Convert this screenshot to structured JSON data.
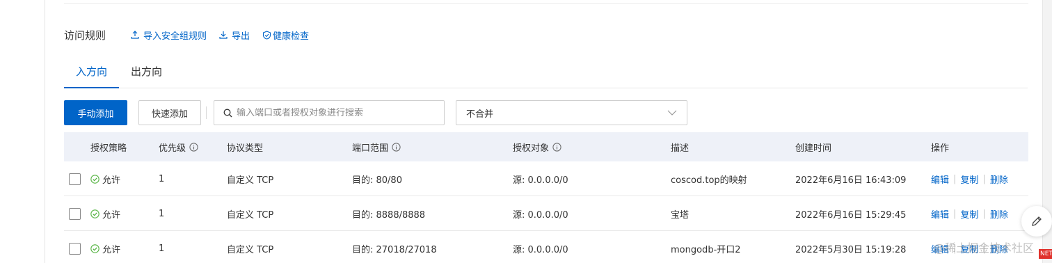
{
  "section": {
    "title": "访问规则",
    "links": {
      "import": "导入安全组规则",
      "export": "导出",
      "health": "健康检查"
    }
  },
  "tabs": {
    "inbound": "入方向",
    "outbound": "出方向"
  },
  "toolbar": {
    "manual_add": "手动添加",
    "quick_add": "快速添加",
    "search_placeholder": "输入端口或者授权对象进行搜索",
    "merge_select": "不合并"
  },
  "table": {
    "headers": {
      "policy": "授权策略",
      "priority": "优先级",
      "protocol": "协议类型",
      "port": "端口范围",
      "target": "授权对象",
      "desc": "描述",
      "created": "创建时间",
      "ops": "操作"
    },
    "rows": [
      {
        "policy": "允许",
        "priority": "1",
        "protocol": "自定义 TCP",
        "port": "目的: 80/80",
        "target": "源: 0.0.0.0/0",
        "desc": "coscod.top的映射",
        "created": "2022年6月16日 16:43:09",
        "edit": "编辑",
        "copy": "复制",
        "delete": "删除"
      },
      {
        "policy": "允许",
        "priority": "1",
        "protocol": "自定义 TCP",
        "port": "目的: 8888/8888",
        "target": "源: 0.0.0.0/0",
        "desc": "宝塔",
        "created": "2022年6月16日 15:29:45",
        "edit": "编辑",
        "copy": "复制",
        "delete": "删除"
      },
      {
        "policy": "允许",
        "priority": "1",
        "protocol": "自定义 TCP",
        "port": "目的: 27018/27018",
        "target": "源: 0.0.0.0/0",
        "desc": "mongodb-开口2",
        "created": "2022年5月30日 15:19:28",
        "edit": "编辑",
        "copy": "复制",
        "delete": "删除"
      }
    ]
  },
  "overlay": {
    "watermark": "@稀土掘金技术社区",
    "badge": "NET"
  },
  "colors": {
    "accent": "#0064c8",
    "success": "#52b23f",
    "header_bg": "#eef1f8"
  },
  "icons": [
    "upload-icon",
    "download-icon",
    "shield-check-icon",
    "search-icon",
    "chevron-down-icon",
    "info-icon",
    "check-circle-icon",
    "edit-pen-icon"
  ]
}
